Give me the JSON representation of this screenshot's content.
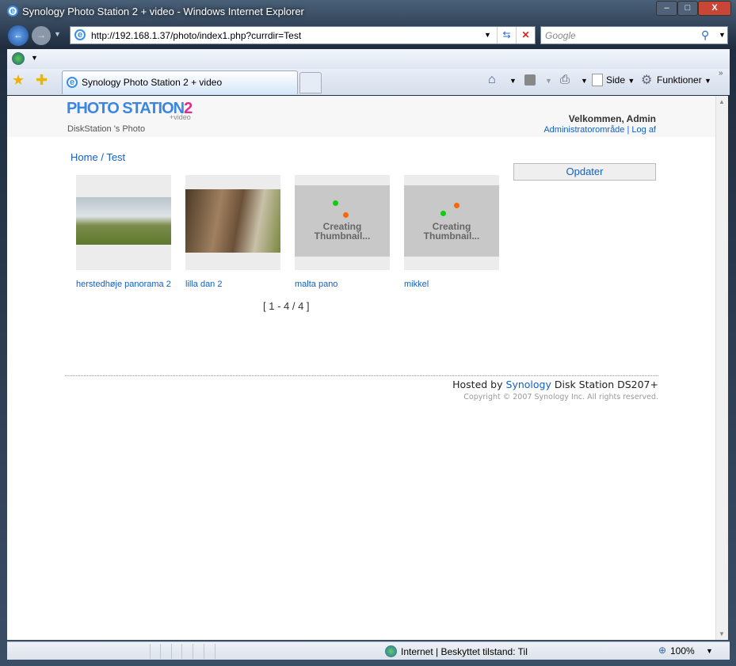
{
  "window": {
    "title": "Synology Photo Station 2 + video - Windows Internet Explorer",
    "minimize": "–",
    "maximize": "□",
    "close": "X"
  },
  "address": {
    "url": "http://192.168.1.37/photo/index1.php?currdir=Test",
    "search_placeholder": "Google"
  },
  "tab": {
    "label": "Synology Photo Station 2 + video"
  },
  "commandbar": {
    "side": "Side",
    "funktioner": "Funktioner"
  },
  "page": {
    "logo": {
      "text": "PHOTO STATION",
      "num": "2",
      "sub": "+video"
    },
    "subtitle": "DiskStation 's Photo",
    "welcome": "Velkommen, Admin",
    "admin_link": "Administratorområde",
    "logout_link": "Log af",
    "breadcrumb": {
      "home": "Home",
      "sep": "/",
      "current": "Test"
    },
    "update_button": "Opdater",
    "items": [
      {
        "name": "herstedhøje panorama 2",
        "status": "image"
      },
      {
        "name": "lilla dan 2",
        "status": "image"
      },
      {
        "name": "malta pano",
        "status": "Creating Thumbnail..."
      },
      {
        "name": "mikkel",
        "status": "Creating Thumbnail..."
      }
    ],
    "creating_l1": "Creating",
    "creating_l2": "Thumbnail...",
    "pagination": "[ 1 - 4 / 4 ]",
    "footer": {
      "hosted_by": "Hosted by",
      "synology": "Synology",
      "device": "Disk Station DS207+",
      "copyright": "Copyright © 2007 Synology Inc. All rights reserved."
    }
  },
  "statusbar": {
    "zone": "Internet | Beskyttet tilstand: Til",
    "zoom": "100%"
  }
}
